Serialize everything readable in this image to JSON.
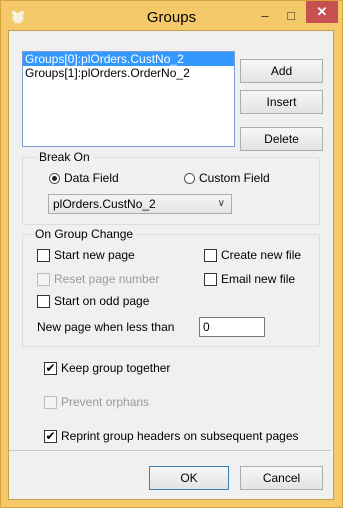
{
  "window": {
    "title": "Groups",
    "minimize": "–",
    "maximize": "□",
    "close": "✕"
  },
  "groups_list": {
    "items": [
      "Groups[0]:plOrders.CustNo_2",
      "Groups[1]:plOrders.OrderNo_2"
    ],
    "selected_index": 0
  },
  "buttons": {
    "add": "Add",
    "insert": "Insert",
    "delete": "Delete",
    "ok": "OK",
    "cancel": "Cancel"
  },
  "break_on": {
    "label": "Break On",
    "data_field": "Data Field",
    "custom_field": "Custom Field",
    "selected": "Data Field",
    "field_value": "plOrders.CustNo_2"
  },
  "on_group_change": {
    "label": "On Group Change",
    "start_new_page": "Start new page",
    "create_new_file": "Create new file",
    "reset_page_number": "Reset page number",
    "email_new_file": "Email new file",
    "start_on_odd_page": "Start on odd page",
    "new_page_when_less_than": "New page when less than",
    "new_page_value": "0"
  },
  "options": {
    "keep_group_together": "Keep group together",
    "prevent_orphans": "Prevent orphans",
    "reprint_headers": "Reprint group headers on subsequent pages"
  },
  "colors": {
    "titlebar": "#f4c96a",
    "selection": "#3399ff",
    "close": "#c75050"
  }
}
